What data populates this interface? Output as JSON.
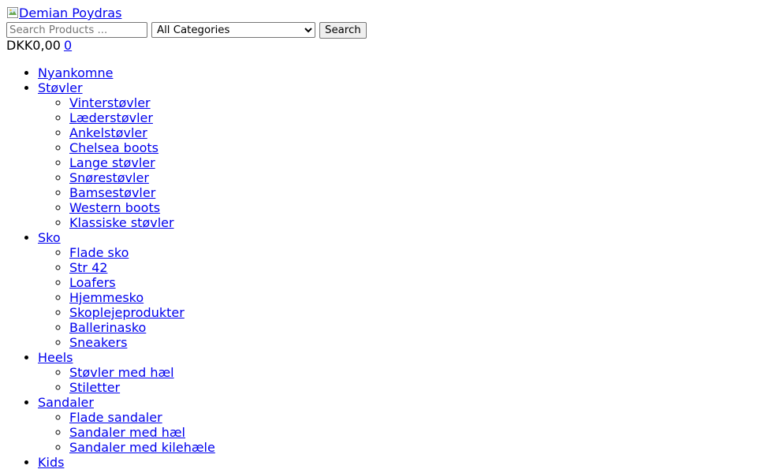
{
  "header": {
    "logo_alt": "Demian Poydras",
    "search": {
      "placeholder": "Search Products ...",
      "category_selected": "All Categories",
      "button_label": "Search"
    },
    "cart": {
      "total": "DKK0,00",
      "count": "0"
    }
  },
  "menu": [
    {
      "label": "Nyankomne",
      "children": []
    },
    {
      "label": "Støvler",
      "children": [
        "Vinterstøvler",
        "Læderstøvler",
        "Ankelstøvler",
        "Chelsea boots",
        "Lange støvler",
        "Snørestøvler",
        "Bamsestøvler",
        "Western boots",
        "Klassiske støvler"
      ]
    },
    {
      "label": "Sko",
      "children": [
        "Flade sko",
        "Str 42",
        "Loafers",
        "Hjemmesko",
        "Skoplejeprodukter",
        "Ballerinasko",
        "Sneakers"
      ]
    },
    {
      "label": "Heels",
      "children": [
        "Støvler med hæl",
        "Stiletter"
      ]
    },
    {
      "label": "Sandaler",
      "children": [
        "Flade sandaler",
        "Sandaler med hæl",
        "Sandaler med kilehæle"
      ]
    },
    {
      "label": "Kids",
      "children": []
    }
  ],
  "colors": {
    "link": "#0000ee",
    "text": "#000000",
    "background": "#ffffff"
  }
}
